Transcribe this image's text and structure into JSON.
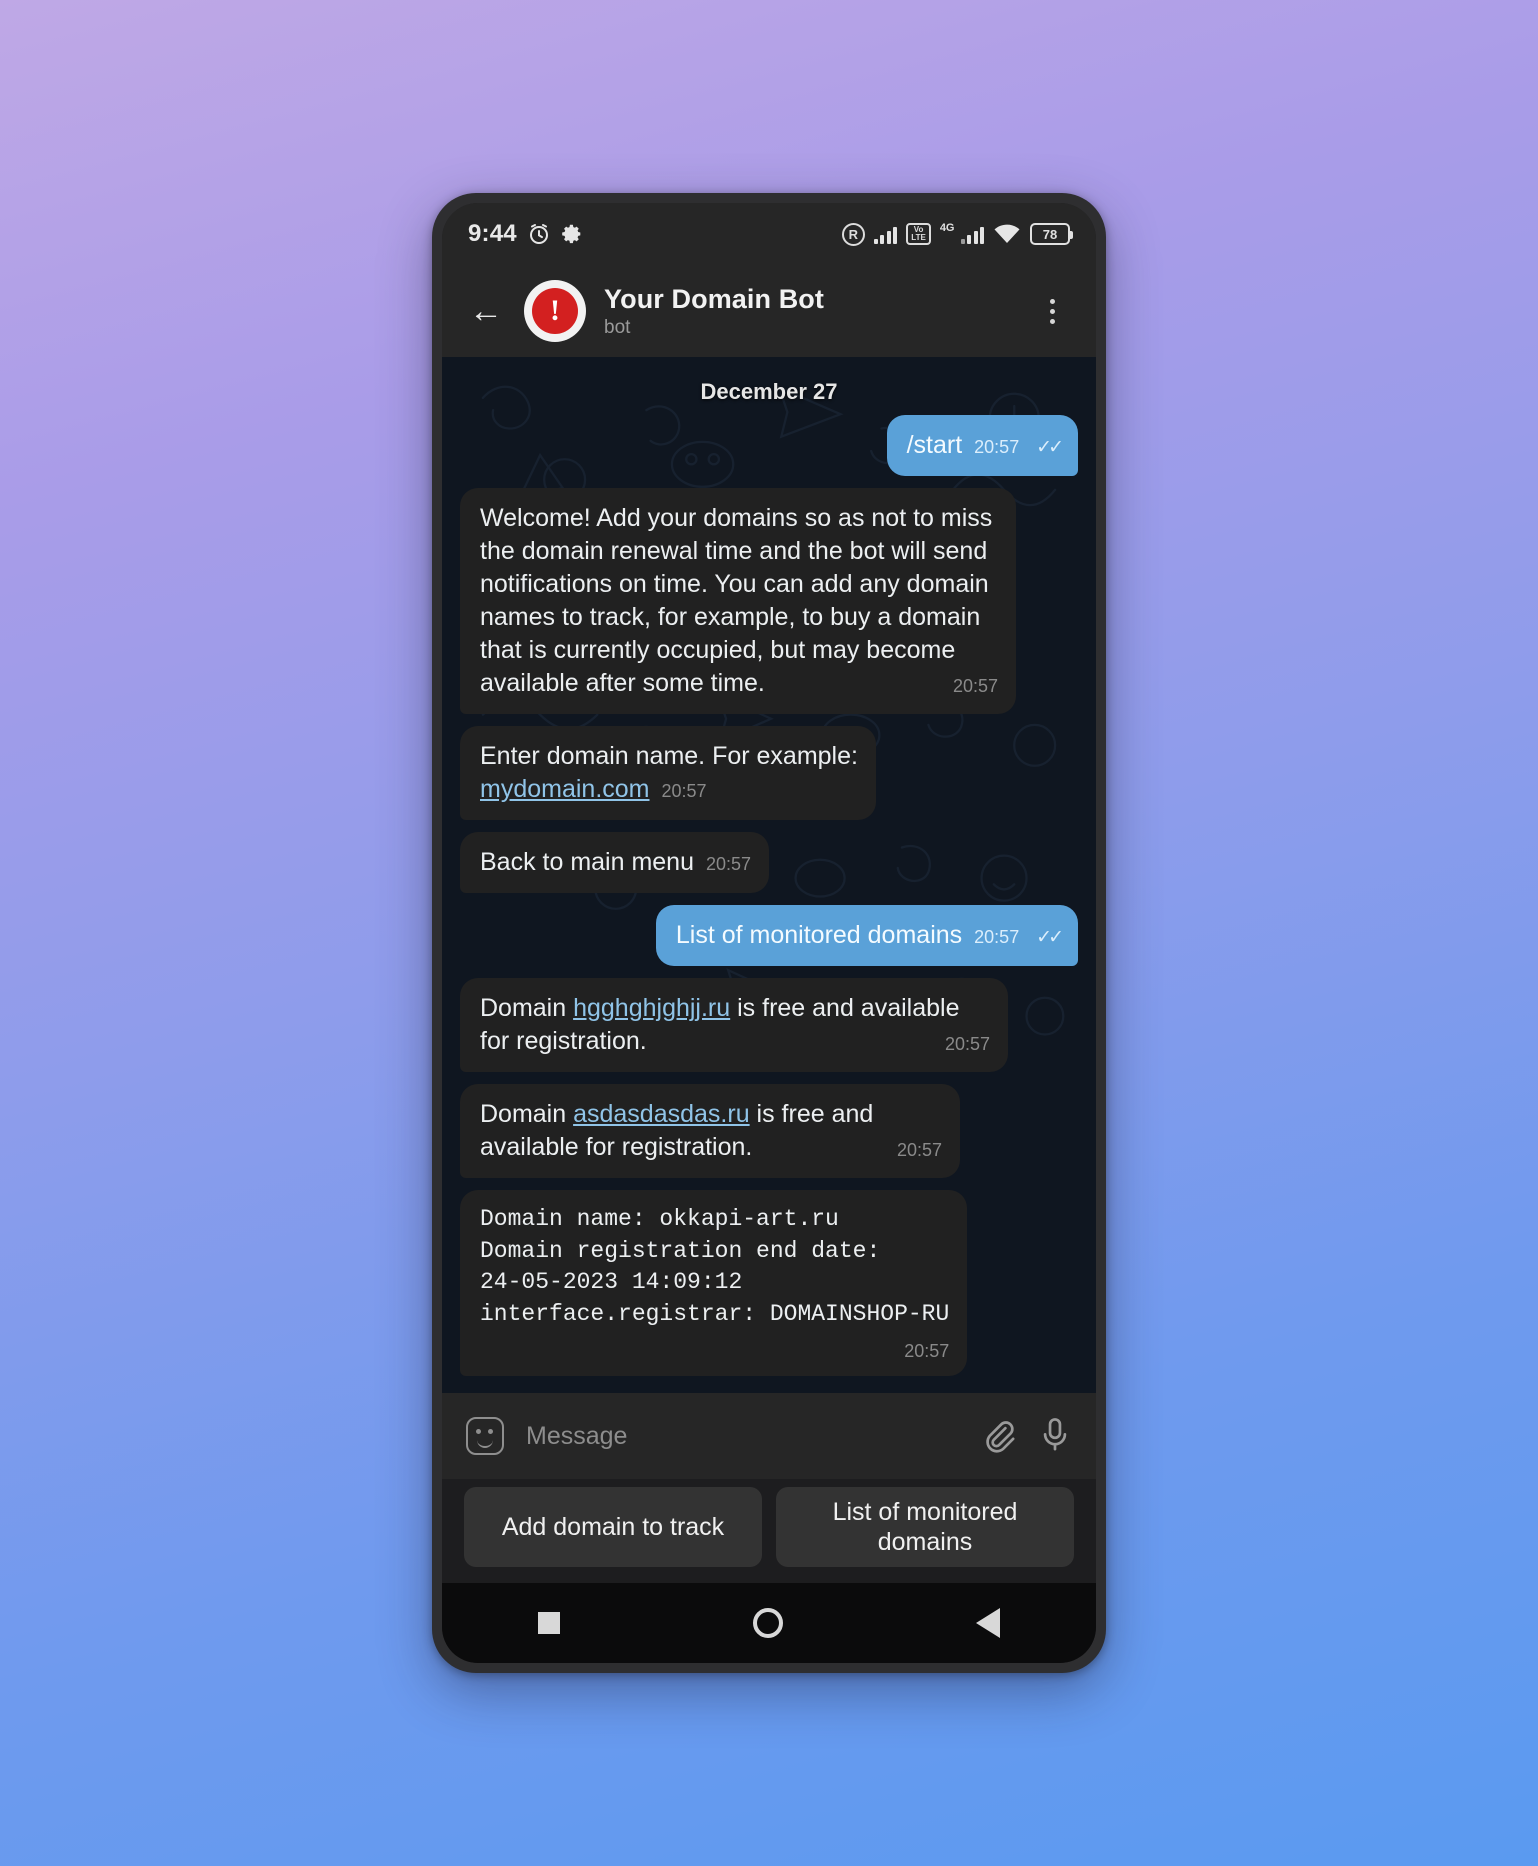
{
  "status_bar": {
    "clock": "9:44",
    "icons": [
      "alarm-icon",
      "gear-icon",
      "roaming-icon",
      "signal-bars-icon",
      "volte-icon",
      "4g-signal-icon",
      "wifi-icon"
    ],
    "volte_top": "Vo",
    "volte_bottom": "LTE",
    "network_4g": "4G",
    "battery_percent": "78"
  },
  "header": {
    "back_icon": "back-arrow-icon",
    "avatar_letter": "!",
    "title": "Your Domain Bot",
    "subtitle": "bot",
    "menu_icon": "overflow-menu-icon"
  },
  "chat": {
    "date_divider": "December 27",
    "messages": [
      {
        "id": "msg-start",
        "side": "out",
        "text": "/start",
        "time": "20:57",
        "ticks": "✓✓",
        "layout": "inline"
      },
      {
        "id": "msg-welcome",
        "side": "in",
        "text": "Welcome! Add your domains so as not to miss the domain renewal time and the bot will send notifications on time. You can add any domain names to track, for example, to buy a domain that is currently occupied, but may become available after some time.",
        "time": "20:57",
        "layout": "block"
      },
      {
        "id": "msg-enter-domain",
        "side": "in",
        "text": "Enter domain name. For example:",
        "link": "mydomain.com",
        "time": "20:57",
        "layout": "link-line"
      },
      {
        "id": "msg-back-menu",
        "side": "in",
        "text": "Back to main menu",
        "time": "20:57",
        "layout": "inline"
      },
      {
        "id": "msg-list-request",
        "side": "out",
        "text": "List of monitored domains",
        "time": "20:57",
        "ticks": "✓✓",
        "layout": "inline"
      },
      {
        "id": "msg-domain-1",
        "side": "in",
        "prefix": "Domain ",
        "link": "hgghghjghjj.ru",
        "suffix": " is free and available for registration.",
        "time": "20:57",
        "layout": "rich"
      },
      {
        "id": "msg-domain-2",
        "side": "in",
        "prefix": "Domain ",
        "link": "asdasdasdas.ru",
        "suffix": " is free and available for registration.",
        "time": "20:57",
        "layout": "rich"
      },
      {
        "id": "msg-domain-info",
        "side": "in",
        "mono": true,
        "lines": [
          "Domain name: okkapi-art.ru",
          "Domain registration end date:",
          "24-05-2023 14:09:12",
          "interface.registrar: DOMAINSHOP-RU"
        ],
        "time": "20:57",
        "layout": "mono"
      }
    ]
  },
  "composer": {
    "sticker_icon": "sticker-smiley-icon",
    "placeholder": "Message",
    "attach_icon": "paperclip-icon",
    "mic_icon": "microphone-icon"
  },
  "reply_keyboard": {
    "buttons": [
      {
        "id": "kbd-add-domain",
        "label": "Add domain to track"
      },
      {
        "id": "kbd-list-domains",
        "label": "List of monitored domains"
      }
    ]
  },
  "nav_bar": {
    "recents_icon": "square-recents-icon",
    "home_icon": "circle-home-icon",
    "back_icon": "triangle-back-icon"
  },
  "colors": {
    "outgoing_bubble": "#5aa1d8",
    "incoming_bubble": "#212121",
    "link": "#90c4e8",
    "chat_background": "#0f1620",
    "avatar_red": "#d32020"
  }
}
